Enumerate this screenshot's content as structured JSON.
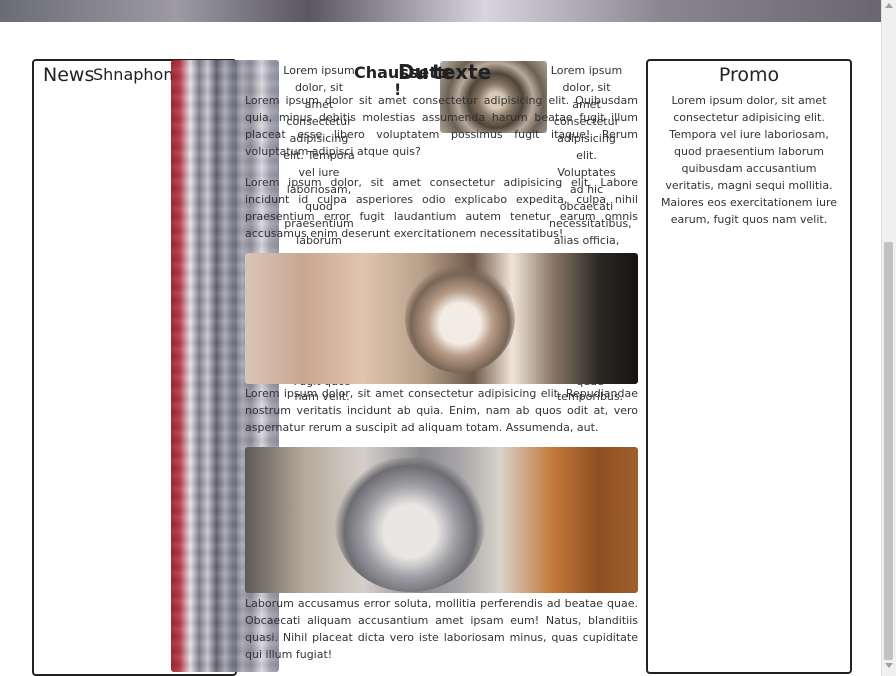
{
  "header": {
    "banner_desc": ""
  },
  "left_panel": {
    "title_news": "News",
    "title_shnaphon": "Shnaphon"
  },
  "center": {
    "title_chaussette": "Chaussette",
    "title_du": "Du",
    "title_texte": "texte",
    "title_bang": "!",
    "column_left_text": "Lorem ipsum dolor, sit amet consectetur adipisicing elit. Tempora vel iure laboriosam, quod praesentium laborum quibusdam",
    "column_left_text_bottom": "Fugit quos nam velit.",
    "column_right_text": "Lorem ipsum dolor, sit amet consectetur adipisicing elit. Voluptates ad hic obcaecati necessitatibus, alias officia, eligendi praesentium",
    "column_right_text_bottom": "quae temporibus.",
    "paragraph_1": "Lorem ipsum dolor sit amet consectetur adipisicing elit. Quibusdam quia, minus debitis molestias assumenda harum beatae fugit illum placeat esse libero voluptatem possimus fugit itaque! Rerum voluptatum adipisci atque quis?",
    "paragraph_2": "Lorem ipsum dolor, sit amet consectetur adipisicing elit. Labore incidunt id culpa asperiores odio explicabo expedita, culpa nihil praesentium error fugit laudantium autem tenetur earum omnis accusamus enim deserunt exercitationem necessitatibus!",
    "paragraph_3": "Lorem ipsum dolor, sit amet consectetur adipisicing elit. Repudiandae nostrum veritatis incidunt ab quia. Enim, nam ab quos odit at, vero aspernatur rerum a suscipit ad aliquam totam. Assumenda, aut.",
    "paragraph_4": "Laborum accusamus error soluta, mollitia perferendis ad beatae quae. Obcaecati aliquam accusantium amet ipsam eum! Natus, blanditiis quasi. Nihil placeat dicta vero iste laboriosam minus, quas cupiditate qui illum fugiat!"
  },
  "right_panel": {
    "title": "Promo",
    "text": "Lorem ipsum dolor, sit amet consectetur adipisicing elit. Tempora vel iure laboriosam, quod praesentium laborum quibusdam accusantium veritatis, magni sequi mollitia. Maiores eos exercitationem iure earum, fugit quos nam velit."
  }
}
